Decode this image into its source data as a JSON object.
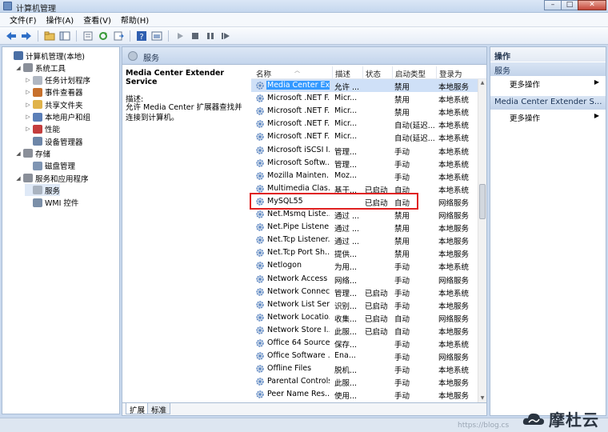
{
  "window": {
    "title": "计算机管理",
    "controls": [
      "–",
      "□",
      "✕"
    ]
  },
  "menu": [
    "文件(F)",
    "操作(A)",
    "查看(V)",
    "帮助(H)"
  ],
  "toolbar": [
    "back-icon",
    "forward-icon",
    "up-folder-icon",
    "show-tree-icon",
    "properties-icon",
    "refresh-icon",
    "export-icon",
    "help-icon",
    "console-icon",
    "play-icon",
    "stop-icon",
    "pause-icon",
    "restart-icon"
  ],
  "tree": [
    {
      "label": "计算机管理(本地)",
      "level": 0,
      "arrow": "",
      "icon": "#4a6fa5"
    },
    {
      "label": "系统工具",
      "level": 1,
      "arrow": "◢",
      "icon": "#8a8f99"
    },
    {
      "label": "任务计划程序",
      "level": 2,
      "arrow": "▷",
      "icon": "#b0b7c2"
    },
    {
      "label": "事件查看器",
      "level": 2,
      "arrow": "▷",
      "icon": "#c7702c"
    },
    {
      "label": "共享文件夹",
      "level": 2,
      "arrow": "▷",
      "icon": "#e0b34a"
    },
    {
      "label": "本地用户和组",
      "level": 2,
      "arrow": "▷",
      "icon": "#5b7fb8"
    },
    {
      "label": "性能",
      "level": 2,
      "arrow": "▷",
      "icon": "#c43d3d"
    },
    {
      "label": "设备管理器",
      "level": 2,
      "arrow": "",
      "icon": "#6d86a8"
    },
    {
      "label": "存储",
      "level": 1,
      "arrow": "◢",
      "icon": "#8a8f99"
    },
    {
      "label": "磁盘管理",
      "level": 2,
      "arrow": "",
      "icon": "#7f95b3"
    },
    {
      "label": "服务和应用程序",
      "level": 1,
      "arrow": "◢",
      "icon": "#8a8f99"
    },
    {
      "label": "服务",
      "level": 2,
      "arrow": "",
      "icon": "#a9b3c0",
      "selected": true
    },
    {
      "label": "WMI 控件",
      "level": 2,
      "arrow": "",
      "icon": "#7b8fa8"
    }
  ],
  "middle": {
    "header": "服务",
    "desc_title": "Media Center Extender Service",
    "desc_label": "描述:",
    "desc_text": "允许 Media Center 扩展器查找并连接到计算机。"
  },
  "columns": [
    "名称",
    "描述",
    "状态",
    "启动类型",
    "登录为"
  ],
  "services": [
    {
      "name": "Media Center Ex...",
      "desc": "允许 ...",
      "status": "",
      "startup": "禁用",
      "logon": "本地服务",
      "selected": true
    },
    {
      "name": "Microsoft .NET F...",
      "desc": "Micr...",
      "status": "",
      "startup": "禁用",
      "logon": "本地系统"
    },
    {
      "name": "Microsoft .NET F...",
      "desc": "Micr...",
      "status": "",
      "startup": "禁用",
      "logon": "本地系统"
    },
    {
      "name": "Microsoft .NET F...",
      "desc": "Micr...",
      "status": "",
      "startup": "自动(延迟...",
      "logon": "本地系统"
    },
    {
      "name": "Microsoft .NET F...",
      "desc": "Micr...",
      "status": "",
      "startup": "自动(延迟...",
      "logon": "本地系统"
    },
    {
      "name": "Microsoft iSCSI I...",
      "desc": "管理...",
      "status": "",
      "startup": "手动",
      "logon": "本地系统"
    },
    {
      "name": "Microsoft Softw...",
      "desc": "管理...",
      "status": "",
      "startup": "手动",
      "logon": "本地系统"
    },
    {
      "name": "Mozilla Mainten...",
      "desc": "Moz...",
      "status": "",
      "startup": "手动",
      "logon": "本地系统"
    },
    {
      "name": "Multimedia Clas...",
      "desc": "基于...",
      "status": "已启动",
      "startup": "自动",
      "logon": "本地系统"
    },
    {
      "name": "MySQL55",
      "desc": "",
      "status": "已启动",
      "startup": "自动",
      "logon": "网络服务"
    },
    {
      "name": "Net.Msmq Liste...",
      "desc": "通过 ...",
      "status": "",
      "startup": "禁用",
      "logon": "网络服务"
    },
    {
      "name": "Net.Pipe Listene...",
      "desc": "通过 ...",
      "status": "",
      "startup": "禁用",
      "logon": "本地服务"
    },
    {
      "name": "Net.Tcp Listener...",
      "desc": "通过 ...",
      "status": "",
      "startup": "禁用",
      "logon": "本地服务"
    },
    {
      "name": "Net.Tcp Port Sh...",
      "desc": "提供...",
      "status": "",
      "startup": "禁用",
      "logon": "本地服务"
    },
    {
      "name": "Netlogon",
      "desc": "为用...",
      "status": "",
      "startup": "手动",
      "logon": "本地系统"
    },
    {
      "name": "Network Access ...",
      "desc": "网络...",
      "status": "",
      "startup": "手动",
      "logon": "网络服务"
    },
    {
      "name": "Network Connec...",
      "desc": "管理...",
      "status": "已启动",
      "startup": "手动",
      "logon": "本地系统"
    },
    {
      "name": "Network List Ser...",
      "desc": "识别...",
      "status": "已启动",
      "startup": "手动",
      "logon": "本地服务"
    },
    {
      "name": "Network Locatio...",
      "desc": "收集...",
      "status": "已启动",
      "startup": "自动",
      "logon": "网络服务"
    },
    {
      "name": "Network Store I...",
      "desc": "此服...",
      "status": "已启动",
      "startup": "自动",
      "logon": "本地服务"
    },
    {
      "name": "Office 64 Source...",
      "desc": "保存...",
      "status": "",
      "startup": "手动",
      "logon": "本地系统"
    },
    {
      "name": "Office Software ...",
      "desc": "Ena...",
      "status": "",
      "startup": "手动",
      "logon": "网络服务"
    },
    {
      "name": "Offline Files",
      "desc": "脱机...",
      "status": "",
      "startup": "手动",
      "logon": "本地系统"
    },
    {
      "name": "Parental Controls",
      "desc": "此服...",
      "status": "",
      "startup": "手动",
      "logon": "本地服务"
    },
    {
      "name": "Peer Name Res...",
      "desc": "使用...",
      "status": "",
      "startup": "手动",
      "logon": "本地服务"
    }
  ],
  "tabs": [
    "扩展",
    "标准"
  ],
  "actions": {
    "title": "操作",
    "section1": "服务",
    "item1": "更多操作",
    "section2": "Media Center Extender S...",
    "item2": "更多操作"
  },
  "watermark": "https://blog.cs",
  "brand": "摩杜云",
  "colors": {
    "selection": "#3399ff",
    "highlight_box": "#e02020",
    "gear": "#5b86c4"
  }
}
